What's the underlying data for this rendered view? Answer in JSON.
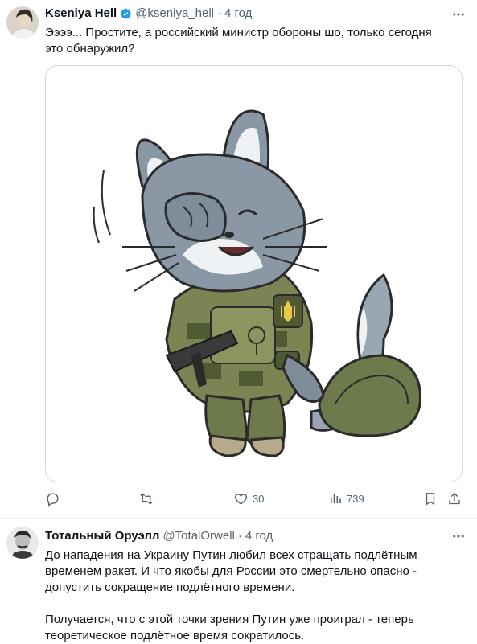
{
  "post1": {
    "author_name": "Kseniya Hell",
    "handle": "@kseniya_hell",
    "separator": "·",
    "time": "4 год",
    "text": "Ээээ... Простите, а российский министр обороны шо, только сегодня это обнаружил?",
    "actions": {
      "reply_count": "",
      "retweet_count": "",
      "like_count": "30",
      "views_count": "739"
    }
  },
  "post2": {
    "author_name": "Тотальный Оруэлл",
    "handle": "@TotalOrwell",
    "separator": "·",
    "time": "4 год",
    "paragraph1": "До нападения на Украину Путин любил всех стращать подлётным временем ракет. И что якобы для России это смертельно опасно - допустить сокращение подлётного времени.",
    "paragraph2": "Получается, что с этой точки зрения Путин уже проиграл - теперь теоретическое подлётное время сократилось."
  },
  "colors": {
    "text": "#0f1419",
    "muted": "#536471",
    "verified": "#1d9bf0",
    "border": "#cfd9de"
  },
  "icons": [
    "verified-badge-icon",
    "more-options-icon",
    "reply-icon",
    "retweet-icon",
    "like-icon",
    "views-icon",
    "bookmark-icon",
    "share-icon"
  ]
}
